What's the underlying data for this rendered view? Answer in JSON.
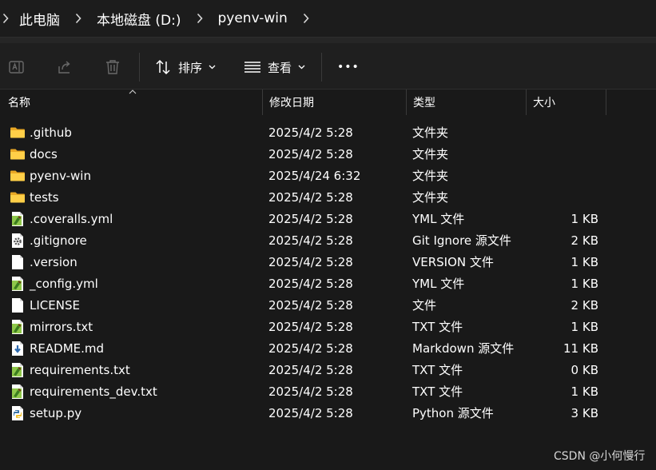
{
  "breadcrumb": {
    "items": [
      "此电脑",
      "本地磁盘 (D:)",
      "pyenv-win"
    ]
  },
  "toolbar": {
    "sort_label": "排序",
    "view_label": "查看",
    "more_label": "•••"
  },
  "columns": {
    "name": "名称",
    "modified": "修改日期",
    "type": "类型",
    "size": "大小"
  },
  "files": [
    {
      "name": ".github",
      "modified": "2025/4/2 5:28",
      "type": "文件夹",
      "size": "",
      "icon": "folder-icon"
    },
    {
      "name": "docs",
      "modified": "2025/4/2 5:28",
      "type": "文件夹",
      "size": "",
      "icon": "folder-icon"
    },
    {
      "name": "pyenv-win",
      "modified": "2025/4/24 6:32",
      "type": "文件夹",
      "size": "",
      "icon": "folder-icon"
    },
    {
      "name": "tests",
      "modified": "2025/4/2 5:28",
      "type": "文件夹",
      "size": "",
      "icon": "folder-icon"
    },
    {
      "name": ".coveralls.yml",
      "modified": "2025/4/2 5:28",
      "type": "YML 文件",
      "size": "1 KB",
      "icon": "notepadpp-file-icon"
    },
    {
      "name": ".gitignore",
      "modified": "2025/4/2 5:28",
      "type": "Git Ignore 源文件",
      "size": "2 KB",
      "icon": "gear-file-icon"
    },
    {
      "name": ".version",
      "modified": "2025/4/2 5:28",
      "type": "VERSION 文件",
      "size": "1 KB",
      "icon": "blank-file-icon"
    },
    {
      "name": "_config.yml",
      "modified": "2025/4/2 5:28",
      "type": "YML 文件",
      "size": "1 KB",
      "icon": "notepadpp-file-icon"
    },
    {
      "name": "LICENSE",
      "modified": "2025/4/2 5:28",
      "type": "文件",
      "size": "2 KB",
      "icon": "blank-file-icon"
    },
    {
      "name": "mirrors.txt",
      "modified": "2025/4/2 5:28",
      "type": "TXT 文件",
      "size": "1 KB",
      "icon": "notepadpp-file-icon"
    },
    {
      "name": "README.md",
      "modified": "2025/4/2 5:28",
      "type": "Markdown 源文件",
      "size": "11 KB",
      "icon": "markdown-file-icon"
    },
    {
      "name": "requirements.txt",
      "modified": "2025/4/2 5:28",
      "type": "TXT 文件",
      "size": "0 KB",
      "icon": "notepadpp-file-icon"
    },
    {
      "name": "requirements_dev.txt",
      "modified": "2025/4/2 5:28",
      "type": "TXT 文件",
      "size": "1 KB",
      "icon": "notepadpp-file-icon"
    },
    {
      "name": "setup.py",
      "modified": "2025/4/2 5:28",
      "type": "Python 源文件",
      "size": "3 KB",
      "icon": "python-file-icon"
    }
  ],
  "watermark": "CSDN @小何慢行"
}
